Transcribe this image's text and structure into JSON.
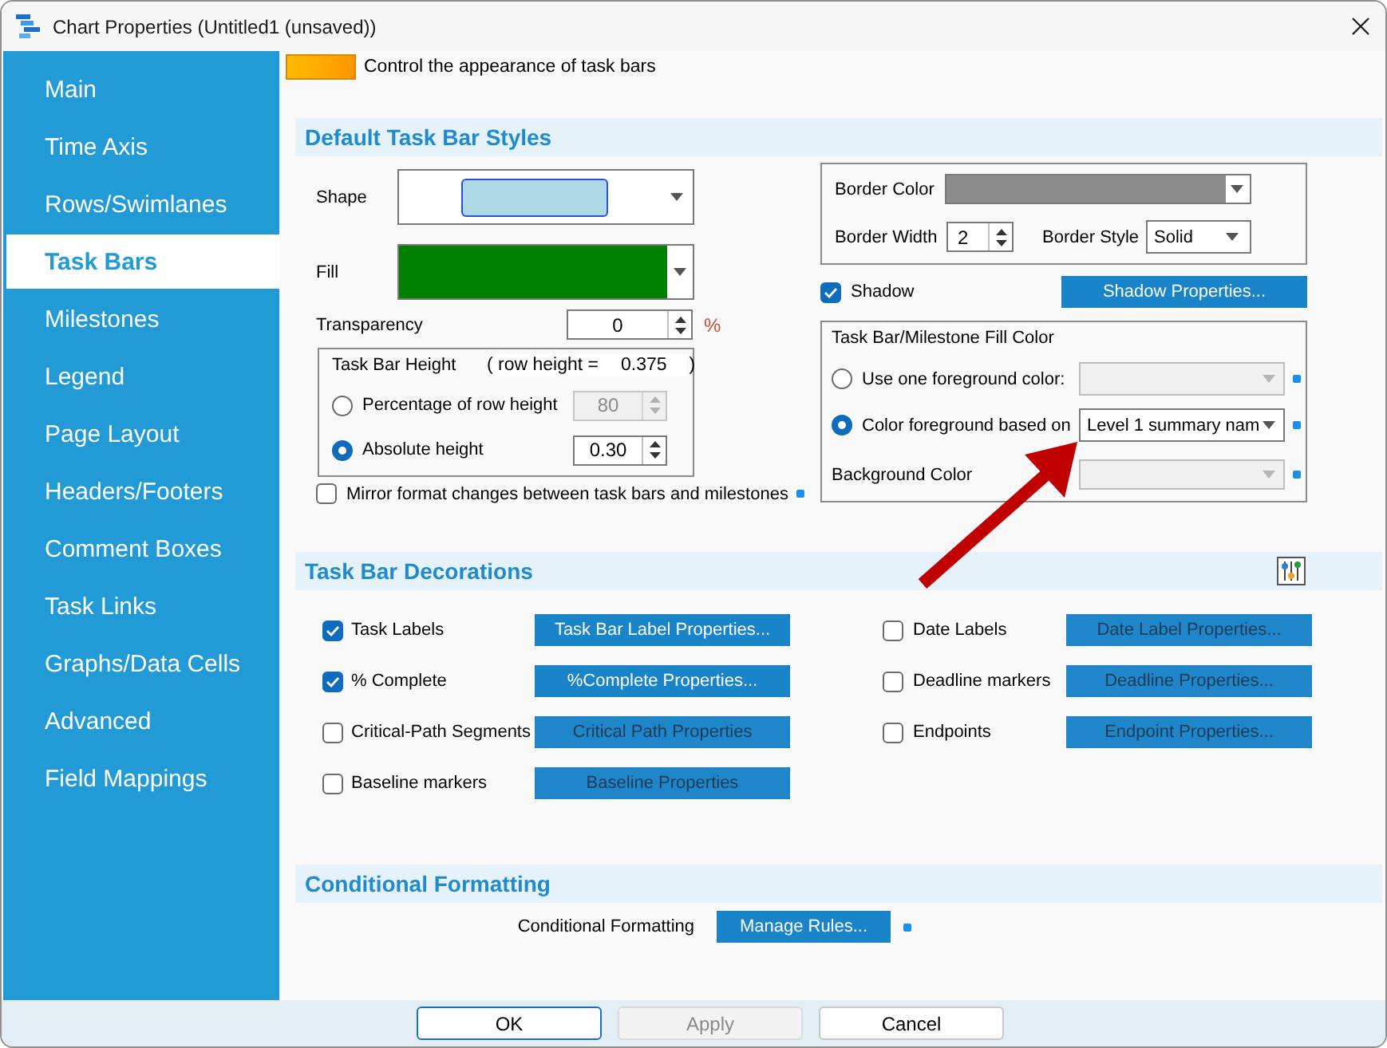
{
  "window": {
    "title": "Chart Properties (Untitled1 (unsaved))"
  },
  "sidebar": {
    "items": [
      {
        "label": "Main",
        "selected": false
      },
      {
        "label": "Time Axis",
        "selected": false
      },
      {
        "label": "Rows/Swimlanes",
        "selected": false
      },
      {
        "label": "Task Bars",
        "selected": true
      },
      {
        "label": "Milestones",
        "selected": false
      },
      {
        "label": "Legend",
        "selected": false
      },
      {
        "label": "Page Layout",
        "selected": false
      },
      {
        "label": "Headers/Footers",
        "selected": false
      },
      {
        "label": "Comment Boxes",
        "selected": false
      },
      {
        "label": "Task Links",
        "selected": false
      },
      {
        "label": "Graphs/Data Cells",
        "selected": false
      },
      {
        "label": "Advanced",
        "selected": false
      },
      {
        "label": "Field Mappings",
        "selected": false
      }
    ]
  },
  "header": {
    "text": "Control the appearance of task bars"
  },
  "default_styles": {
    "title": "Default Task Bar Styles",
    "shape_label": "Shape",
    "fill_label": "Fill",
    "transparency": {
      "label": "Transparency",
      "value": "0",
      "unit": "%"
    },
    "bar_height": {
      "title": "Task Bar Height",
      "row_height_label": "( row height =",
      "row_height_value": "0.375",
      "row_height_end": ")",
      "options": [
        {
          "label": "Percentage of row height",
          "selected": false,
          "value": "80",
          "disabled": true
        },
        {
          "label": "Absolute height",
          "selected": true,
          "value": "0.30",
          "disabled": false
        }
      ]
    },
    "mirror": {
      "label": "Mirror format changes between task bars and milestones",
      "checked": false
    },
    "border": {
      "color_label": "Border Color",
      "width_label": "Border Width",
      "width_value": "2",
      "style_label": "Border Style",
      "style_value": "Solid"
    },
    "shadow": {
      "label": "Shadow",
      "checked": true,
      "button": "Shadow Properties..."
    },
    "fill_color": {
      "title": "Task Bar/Milestone Fill Color",
      "options": [
        {
          "label": "Use one foreground color:",
          "selected": false,
          "disabled": true
        },
        {
          "label": "Color foreground based on",
          "selected": true,
          "value": "Level 1 summary nam",
          "disabled": false
        }
      ],
      "background": {
        "label": "Background Color",
        "disabled": true
      }
    }
  },
  "decorations": {
    "title": "Task Bar Decorations",
    "columns": [
      [
        {
          "label": "Task Labels",
          "checked": true,
          "button": "Task Bar Label Properties...",
          "button_disabled": false
        },
        {
          "label": "% Complete",
          "checked": true,
          "button": "%Complete Properties...",
          "button_disabled": false
        },
        {
          "label": "Critical-Path Segments",
          "checked": false,
          "button": "Critical Path Properties",
          "button_disabled": true
        },
        {
          "label": "Baseline markers",
          "checked": false,
          "button": "Baseline Properties",
          "button_disabled": true
        }
      ],
      [
        {
          "label": "Date Labels",
          "checked": false,
          "button": "Date Label Properties...",
          "button_disabled": true
        },
        {
          "label": "Deadline markers",
          "checked": false,
          "button": "Deadline Properties...",
          "button_disabled": true
        },
        {
          "label": "Endpoints",
          "checked": false,
          "button": "Endpoint Properties...",
          "button_disabled": true
        }
      ]
    ]
  },
  "conditional": {
    "title": "Conditional Formatting",
    "label": "Conditional Formatting",
    "button": "Manage Rules..."
  },
  "footer": {
    "buttons": [
      {
        "label": "OK",
        "default": true,
        "disabled": false
      },
      {
        "label": "Apply",
        "default": false,
        "disabled": true
      },
      {
        "label": "Cancel",
        "default": false,
        "disabled": false
      }
    ]
  }
}
